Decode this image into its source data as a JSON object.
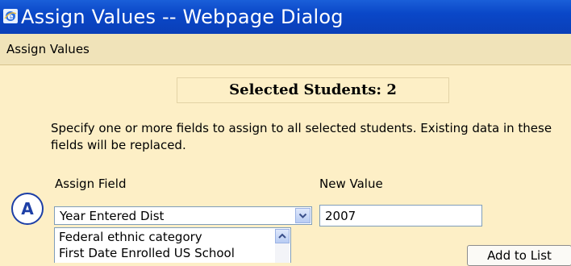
{
  "window": {
    "title": "Assign Values -- Webpage Dialog",
    "icon": "ie-icon"
  },
  "menubar": {
    "label": "Assign Values"
  },
  "selected": {
    "text": "Selected Students: 2"
  },
  "instructions": "Specify one or more fields to assign to all selected students. Existing data in these fields will be replaced.",
  "form": {
    "assign_field_label": "Assign Field",
    "new_value_label": "New Value",
    "assign_field_value": "Year Entered Dist",
    "new_value": "2007",
    "list_options": [
      "Federal ethnic category",
      "First Date Enrolled US School"
    ],
    "add_button_label": "Add to List"
  },
  "callout": {
    "label": "A"
  },
  "colors": {
    "titlebar": "#0a47c8",
    "background": "#fdefc6",
    "menubar": "#f0e3b9",
    "callout": "#1d3fa6"
  }
}
